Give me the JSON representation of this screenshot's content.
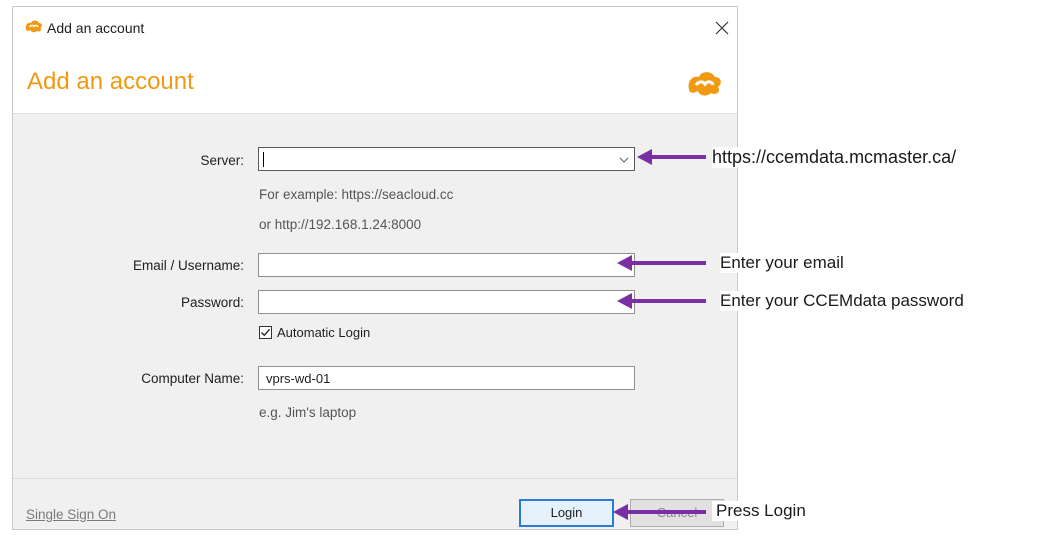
{
  "window": {
    "title": "Add an account",
    "close_glyph": "✕"
  },
  "header": {
    "heading": "Add an account"
  },
  "form": {
    "server_label": "Server:",
    "server_value": "",
    "server_hint_1": "For example: https://seacloud.cc",
    "server_hint_2": "or http://192.168.1.24:8000",
    "email_label": "Email / Username:",
    "email_value": "",
    "password_label": "Password:",
    "password_value": "",
    "auto_login_label": "Automatic Login",
    "auto_login_checked": true,
    "computer_label": "Computer Name:",
    "computer_value": "vprs-wd-01",
    "computer_hint": "e.g. Jim's laptop"
  },
  "footer": {
    "sso_link": "Single Sign On",
    "login_button": "Login",
    "cancel_button": "Cancel"
  },
  "annotations": {
    "server_note": "https://ccemdata.mcmaster.ca/",
    "email_note": "Enter your email",
    "password_note": "Enter your CCEMdata password",
    "login_note": "Press Login"
  },
  "colors": {
    "brand_orange": "#ef9a12",
    "annotation_arrow": "#7b2fa5",
    "focus_blue": "#2c7ad8"
  },
  "icons": {
    "app": "seafile-logo-icon",
    "close": "close-icon",
    "dropdown": "chevron-down-icon",
    "check": "check-icon"
  }
}
